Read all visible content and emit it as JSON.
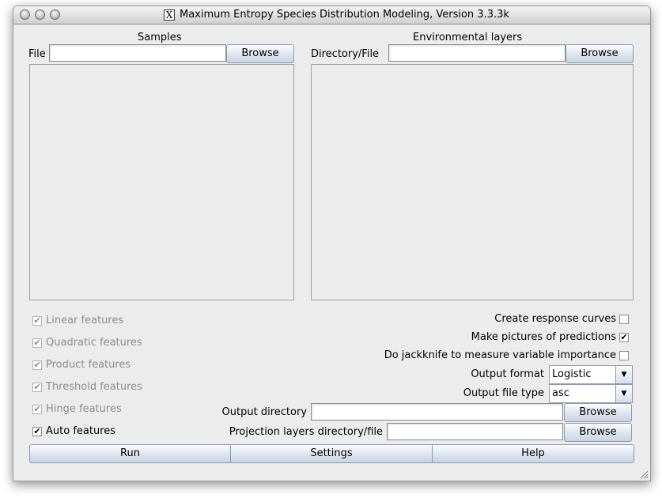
{
  "window": {
    "title": "Maximum Entropy Species Distribution Modeling, Version 3.3.3k",
    "x11_glyph": "X"
  },
  "samples": {
    "heading": "Samples",
    "file_label": "File",
    "file_value": "",
    "browse_label": "Browse"
  },
  "environmental": {
    "heading": "Environmental layers",
    "dir_label": "Directory/File",
    "dir_value": "",
    "browse_label": "Browse"
  },
  "features": [
    {
      "label": "Linear features",
      "checked": true,
      "enabled": false
    },
    {
      "label": "Quadratic features",
      "checked": true,
      "enabled": false
    },
    {
      "label": "Product features",
      "checked": true,
      "enabled": false
    },
    {
      "label": "Threshold features",
      "checked": true,
      "enabled": false
    },
    {
      "label": "Hinge features",
      "checked": true,
      "enabled": false
    },
    {
      "label": "Auto features",
      "checked": true,
      "enabled": true
    }
  ],
  "options": {
    "response_curves": {
      "label": "Create response curves",
      "checked": false
    },
    "make_pictures": {
      "label": "Make pictures of predictions",
      "checked": true
    },
    "jackknife": {
      "label": "Do jackknife to measure variable importance",
      "checked": false
    },
    "output_format": {
      "label": "Output format",
      "value": "Logistic"
    },
    "output_file_type": {
      "label": "Output file type",
      "value": "asc"
    }
  },
  "output_directory": {
    "label": "Output directory",
    "value": "",
    "browse_label": "Browse"
  },
  "projection_layers": {
    "label": "Projection layers directory/file",
    "value": "",
    "browse_label": "Browse"
  },
  "check_glyph": "✔",
  "bottom_buttons": {
    "run": "Run",
    "settings": "Settings",
    "help": "Help"
  }
}
